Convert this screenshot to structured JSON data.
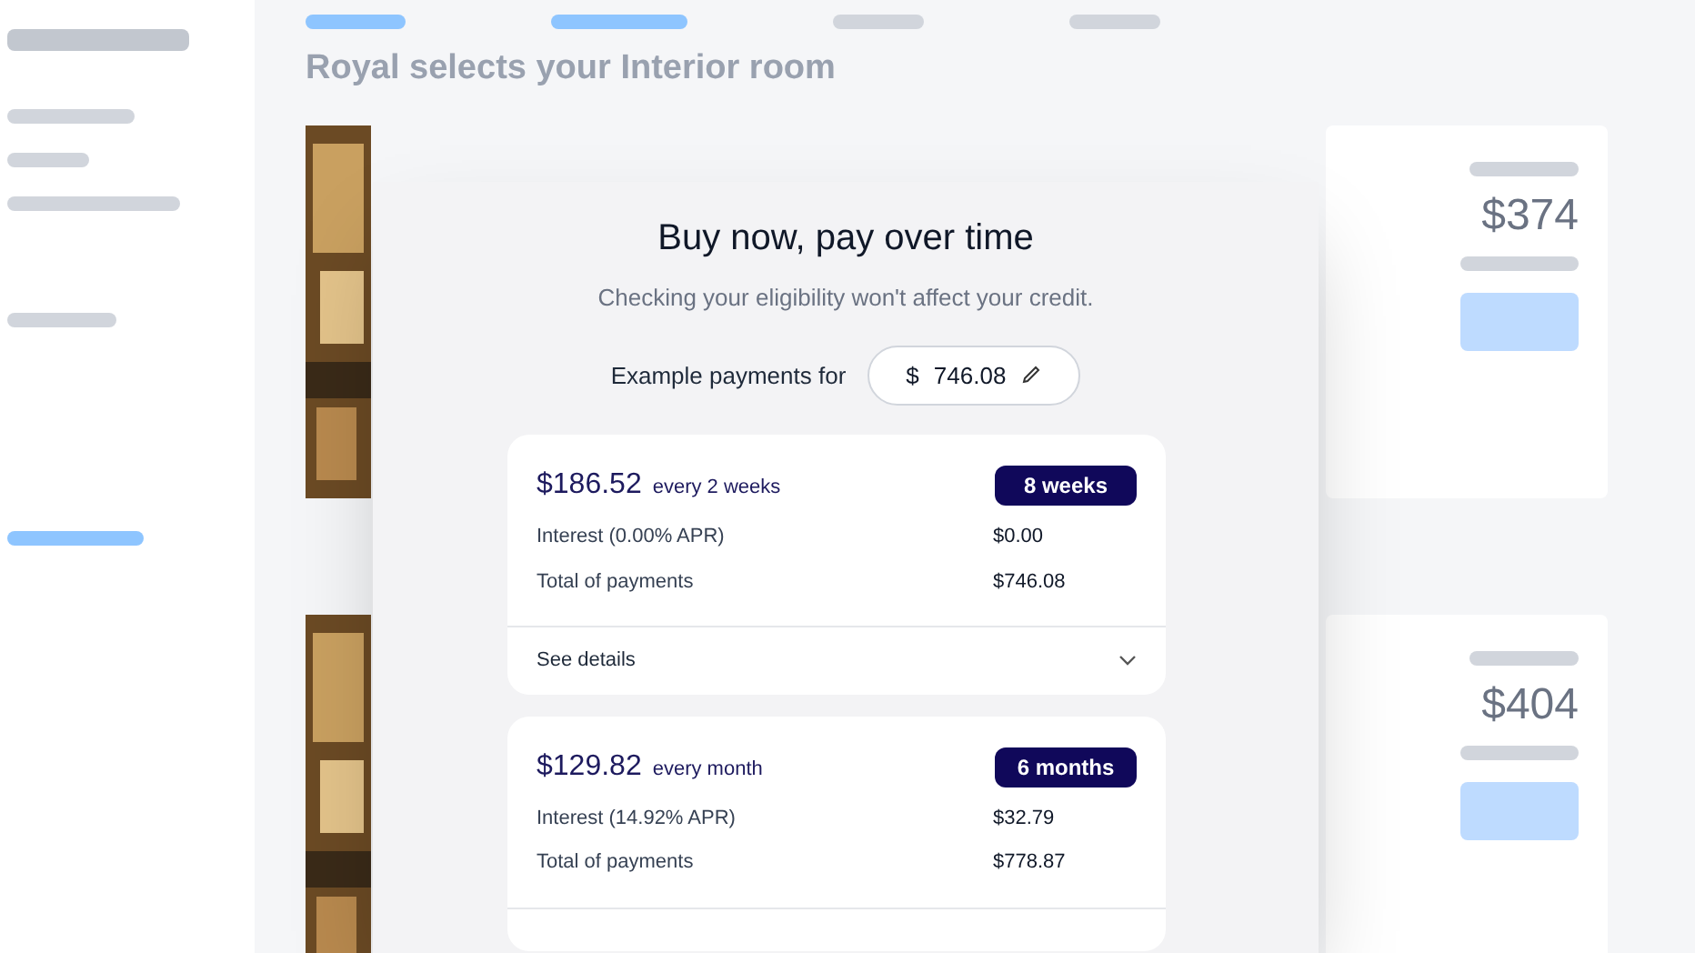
{
  "background": {
    "heading": "Royal selects your Interior room",
    "price_cards": [
      {
        "price": "$374"
      },
      {
        "price": "$404"
      }
    ]
  },
  "modal": {
    "title": "Buy now, pay over time",
    "subtitle": "Checking your eligibility won't affect your credit.",
    "amount_label": "Example payments for",
    "currency": "$",
    "amount": "746.08",
    "plans": [
      {
        "payment": "$186.52",
        "frequency": "every 2 weeks",
        "term": "8 weeks",
        "interest_label": "Interest (0.00% APR)",
        "interest": "$0.00",
        "total_label": "Total of payments",
        "total": "$746.08",
        "details": "See details"
      },
      {
        "payment": "$129.82",
        "frequency": "every month",
        "term": "6 months",
        "interest_label": "Interest (14.92% APR)",
        "interest": "$32.79",
        "total_label": "Total of payments",
        "total": "$778.87"
      }
    ]
  }
}
